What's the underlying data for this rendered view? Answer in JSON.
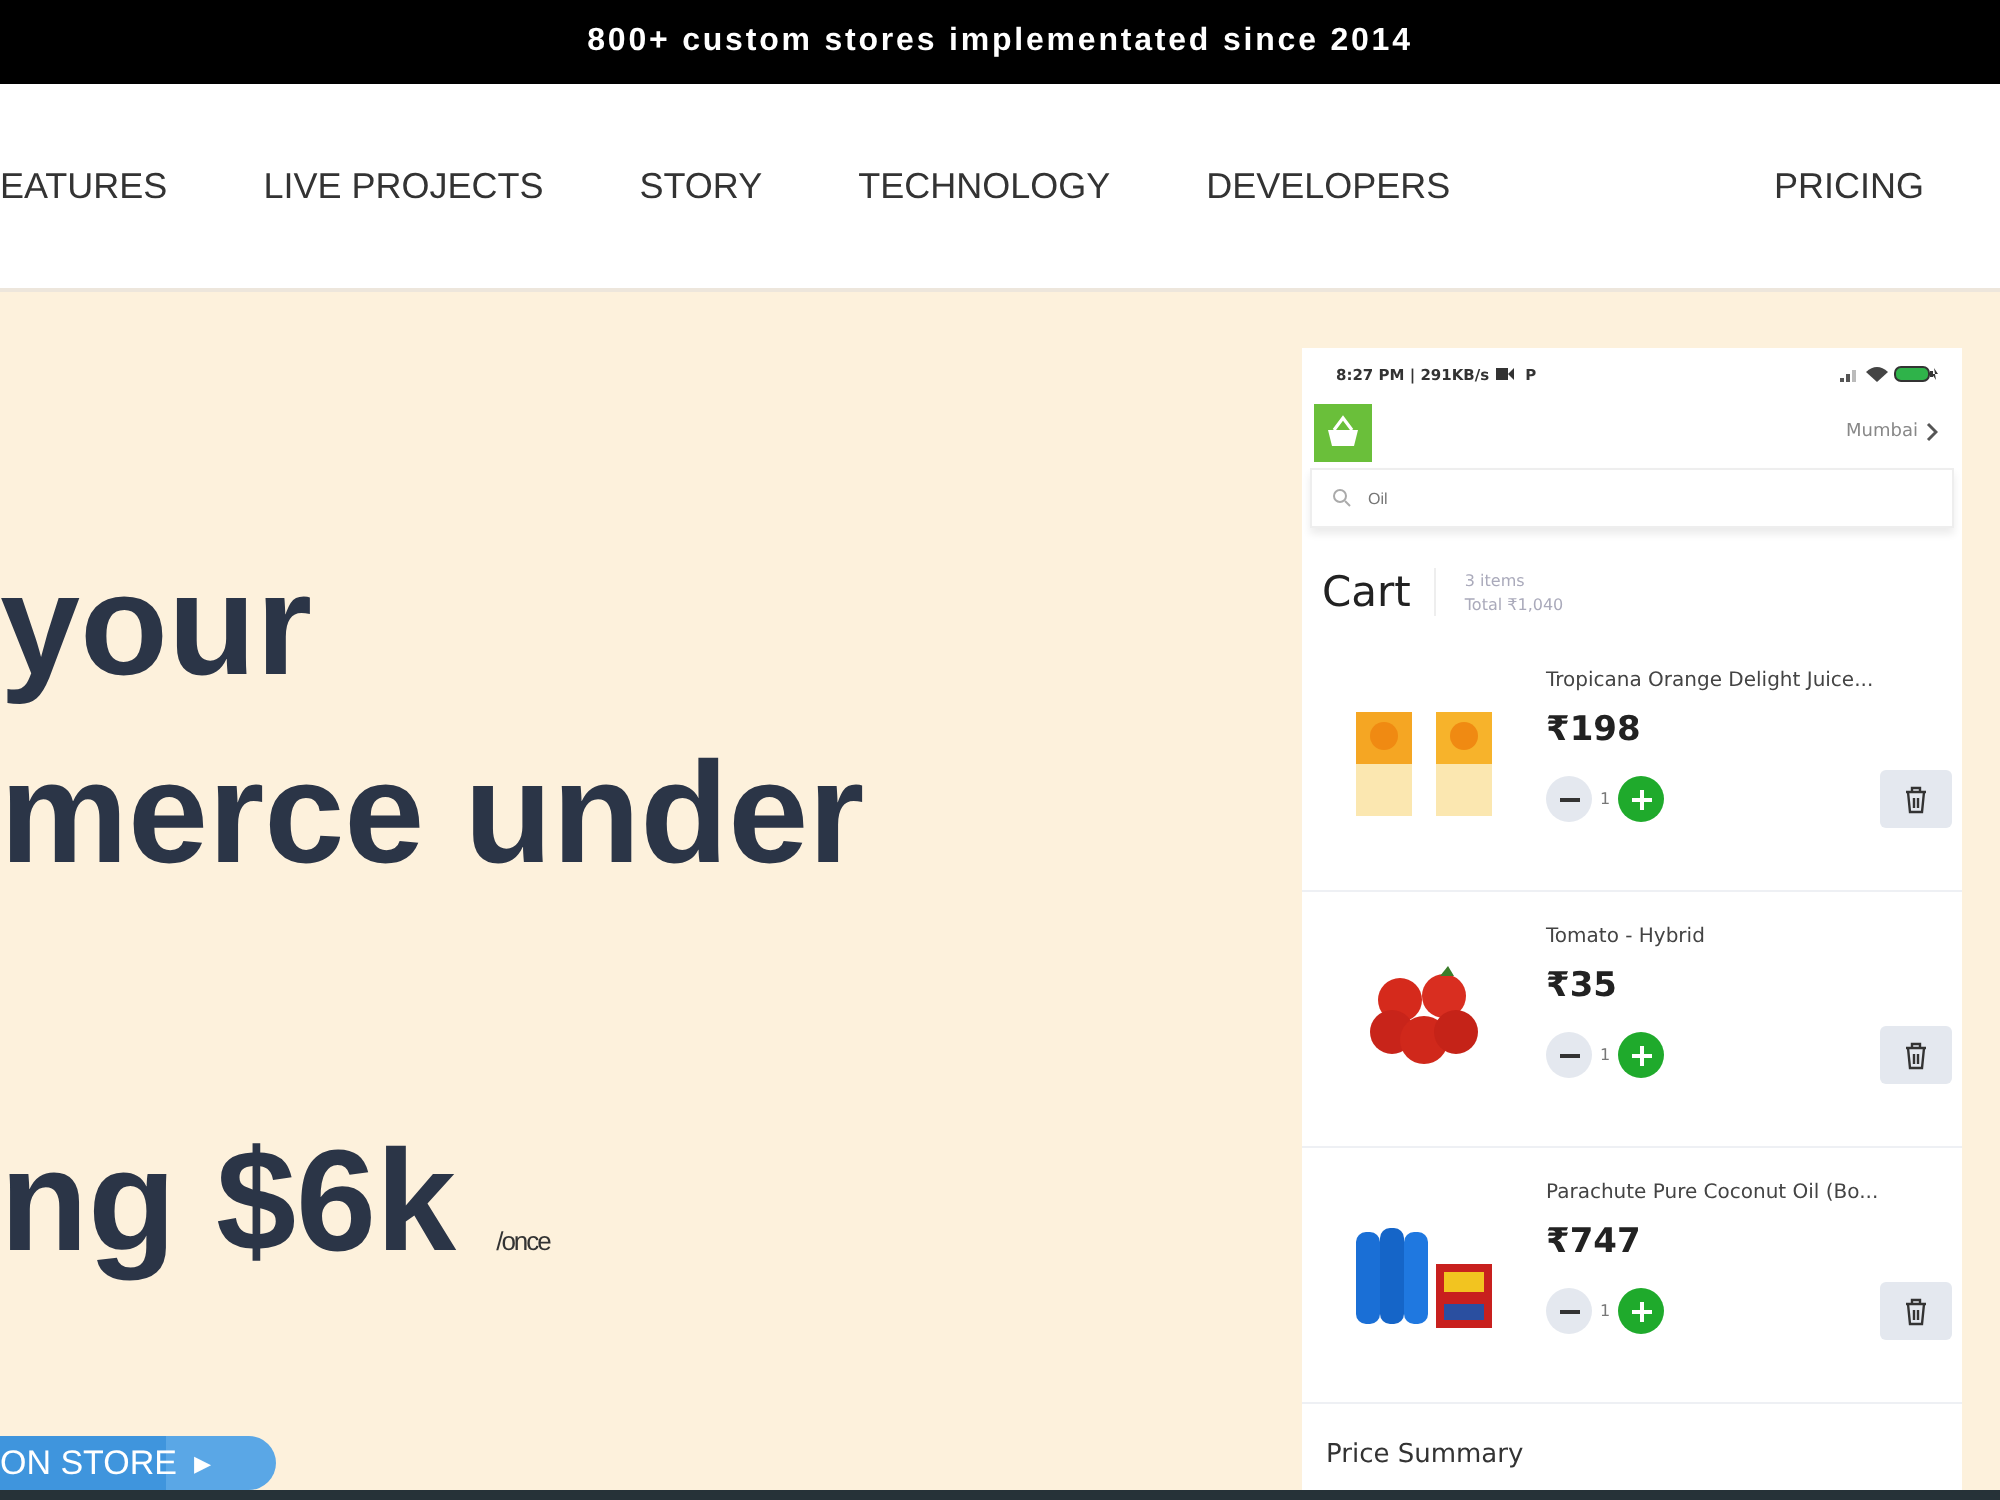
{
  "announcement": "800+ custom stores implementated since 2014",
  "nav": {
    "items": [
      "EATURES",
      "LIVE PROJECTS",
      "STORY",
      "TECHNOLOGY",
      "DEVELOPERS"
    ],
    "pricing": "PRICING"
  },
  "hero": {
    "lines": [
      "your",
      "merce under"
    ],
    "price_line": "ng $6k",
    "price_suffix": "/once",
    "cta": "ON STORE",
    "cta_icon": "▸"
  },
  "phone": {
    "status": {
      "time": "8:27 PM | 291KB/s",
      "indicator": "P"
    },
    "location": "Mumbai",
    "search": {
      "value": "Oil"
    },
    "cart": {
      "title": "Cart",
      "count": "3 items",
      "total": "Total ₹1,040"
    },
    "items": [
      {
        "name": "Tropicana Orange Delight Juice...",
        "price": "₹198",
        "qty": "1"
      },
      {
        "name": "Tomato - Hybrid",
        "price": "₹35",
        "qty": "1"
      },
      {
        "name": "Parachute Pure Coconut Oil (Bo...",
        "price": "₹747",
        "qty": "1"
      }
    ],
    "summary_title": "Price Summary"
  }
}
